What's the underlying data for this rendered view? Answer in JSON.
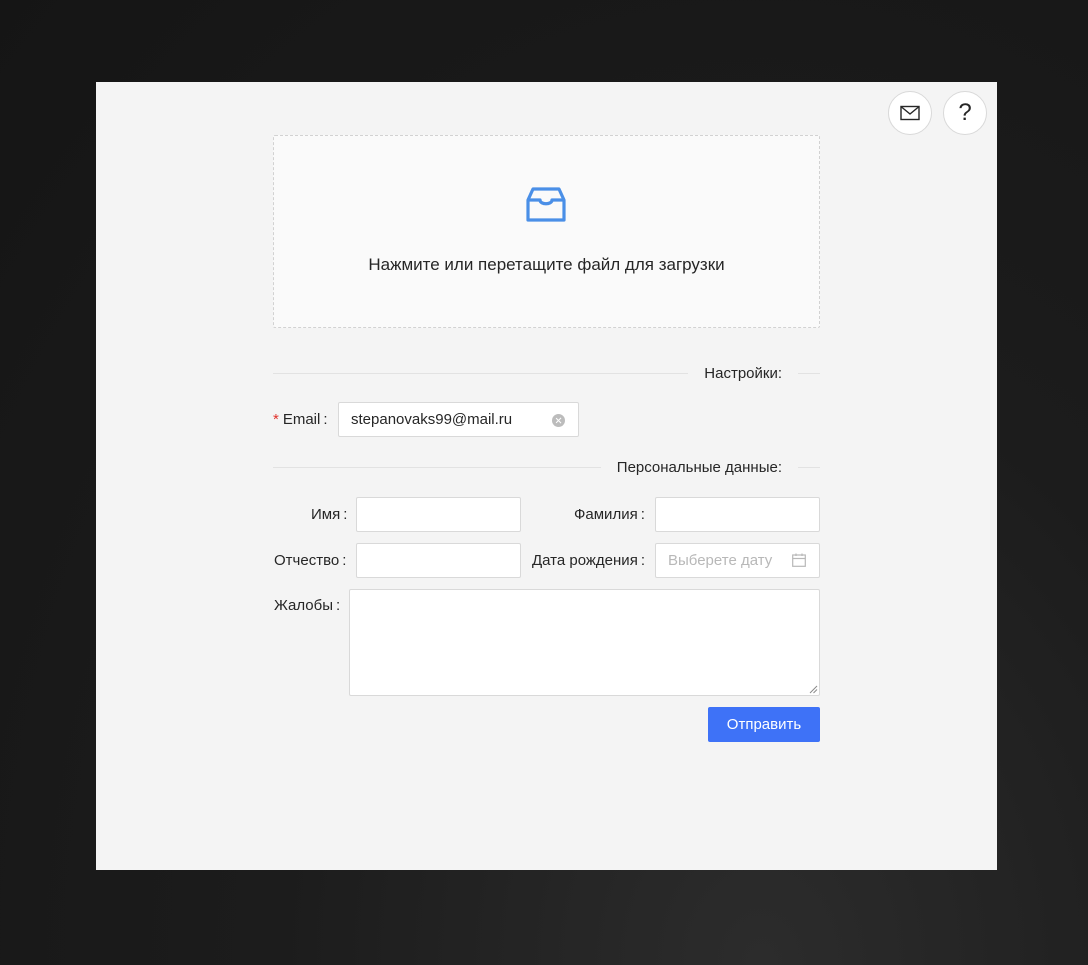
{
  "header": {
    "mail_icon": "mail-icon",
    "help_icon": "question-icon",
    "help_glyph": "?"
  },
  "upload": {
    "icon": "inbox-icon",
    "text": "Нажмите или перетащите файл для загрузки",
    "accent_color": "#4a8fe7"
  },
  "settings": {
    "section_title": "Настройки:",
    "email_label": "Email",
    "email_required_mark": "*",
    "email_value": "stepanovaks99@mail.ru"
  },
  "personal": {
    "section_title": "Персональные данные:",
    "first_name_label": "Имя",
    "first_name_value": "",
    "last_name_label": "Фамилия",
    "last_name_value": "",
    "patronymic_label": "Отчество",
    "patronymic_value": "",
    "birthdate_label": "Дата рождения",
    "birthdate_placeholder": "Выберете дату",
    "complaints_label": "Жалобы",
    "complaints_value": ""
  },
  "colon": ":",
  "actions": {
    "submit_label": "Отправить",
    "submit_color": "#3e72f7"
  }
}
